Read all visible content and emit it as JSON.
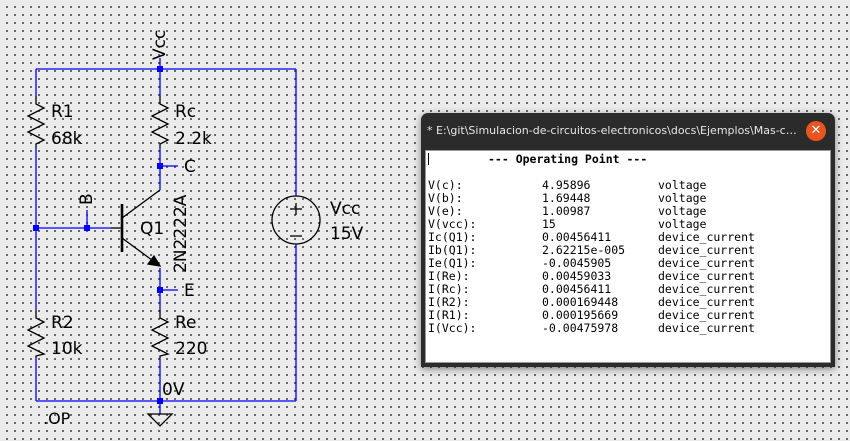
{
  "schematic": {
    "labels": {
      "vcc_net": "Vcc",
      "r1_name": "R1",
      "r1_value": "68k",
      "rc_name": "Rc",
      "rc_value": "2.2k",
      "c_node": "C",
      "b_node": "B",
      "q1_name": "Q1",
      "q1_model": "2N2222A",
      "e_node": "E",
      "r2_name": "R2",
      "r2_value": "10k",
      "re_name": "Re",
      "re_value": "220",
      "gnd_node": "0V",
      "vsrc_name": "Vcc",
      "vsrc_value": "15V",
      "directive": ".OP"
    },
    "colors": {
      "wire": "#0000ff",
      "component": "#000000",
      "junction": "#0000ff"
    }
  },
  "output_window": {
    "title": "* E:\\git\\Simulacion-de-circuitos-electronicos\\docs\\Ejemplos\\Mas-conceptos...",
    "close_icon": "close-icon",
    "header": "--- Operating Point ---",
    "rows": [
      {
        "name": "V(c):",
        "value": "4.95896",
        "type": "voltage"
      },
      {
        "name": "V(b):",
        "value": "1.69448",
        "type": "voltage"
      },
      {
        "name": "V(e):",
        "value": "1.00987",
        "type": "voltage"
      },
      {
        "name": "V(vcc):",
        "value": "15",
        "type": "voltage"
      },
      {
        "name": "Ic(Q1):",
        "value": "0.00456411",
        "type": "device_current"
      },
      {
        "name": "Ib(Q1):",
        "value": "2.62215e-005",
        "type": "device_current"
      },
      {
        "name": "Ie(Q1):",
        "value": "-0.0045905",
        "type": "device_current"
      },
      {
        "name": "I(Re):",
        "value": "0.00459033",
        "type": "device_current"
      },
      {
        "name": "I(Rc):",
        "value": "0.00456411",
        "type": "device_current"
      },
      {
        "name": "I(R2):",
        "value": "0.000169448",
        "type": "device_current"
      },
      {
        "name": "I(R1):",
        "value": "0.000195669",
        "type": "device_current"
      },
      {
        "name": "I(Vcc):",
        "value": "-0.00475978",
        "type": "device_current"
      }
    ],
    "colors": {
      "titlebar": "#2b2b2b",
      "close_button": "#e95420"
    }
  }
}
